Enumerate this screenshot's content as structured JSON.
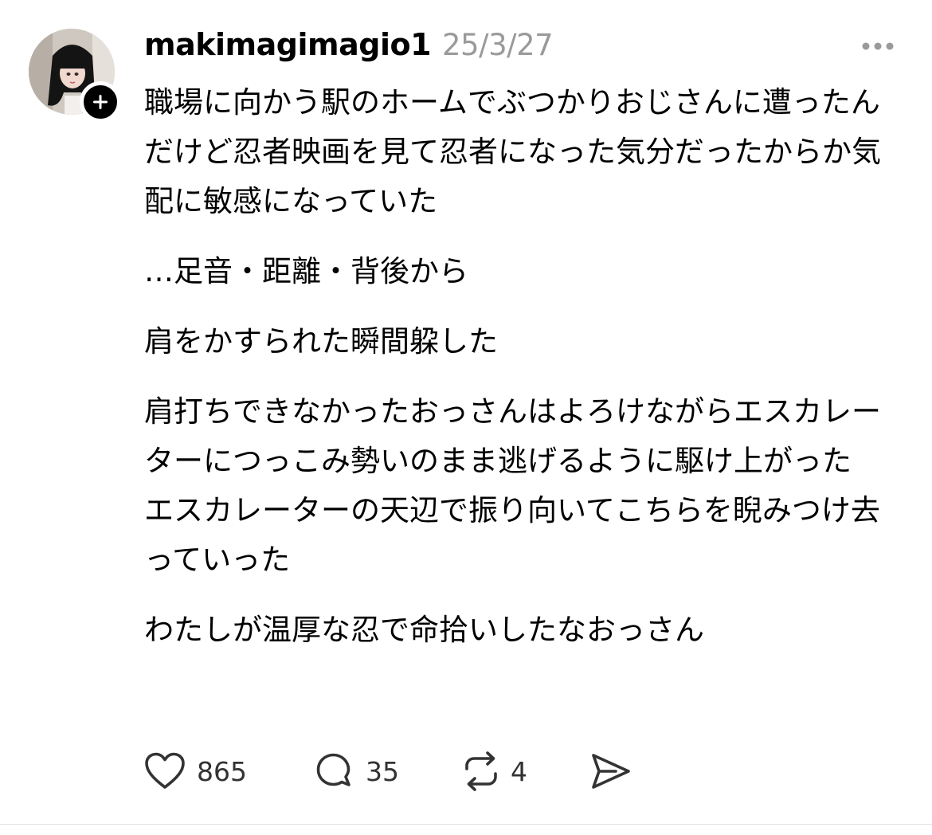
{
  "post": {
    "author": {
      "username": "makimagimagio1",
      "avatar_icon": "profile-photo",
      "follow_icon": "plus-icon"
    },
    "timestamp": "25/3/27",
    "more_icon": "more-horizontal-icon",
    "paragraphs": [
      "職場に向かう駅のホームでぶつかりおじさんに遭ったんだけど忍者映画を見て忍者になった気分だったからか気配に敏感になっていた",
      "…足音・距離・背後から",
      "肩をかすられた瞬間躱した",
      "肩打ちできなかったおっさんはよろけながらエスカレーターにつっこみ勢いのまま逃げるように駆け上がった\nエスカレーターの天辺で振り向いてこちらを睨みつけ去っていった",
      "わたしが温厚な忍で命拾いしたなおっさん"
    ],
    "actions": {
      "like": {
        "icon": "heart-icon",
        "count": "865"
      },
      "reply": {
        "icon": "speech-bubble-icon",
        "count": "35"
      },
      "repost": {
        "icon": "repost-icon",
        "count": "4"
      },
      "share": {
        "icon": "send-icon"
      }
    }
  },
  "colors": {
    "text": "#000000",
    "timestamp": "#9a9a9a",
    "icon": "#333333",
    "divider": "#e2e2e2"
  }
}
